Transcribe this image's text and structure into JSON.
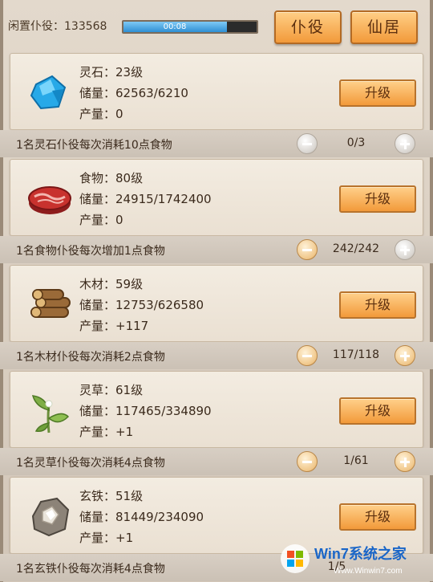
{
  "header": {
    "idle_label": "闲置仆役：133568",
    "timer": "00:08",
    "timer_progress": 0.78,
    "btn_servant": "仆役",
    "btn_residence": "仙居"
  },
  "resources": [
    {
      "name": "灵石：23级",
      "storage": "储量：62563/6210",
      "output": "产量：0",
      "upgrade": "升级",
      "cost_text": "1名灵石仆役每次消耗10点食物",
      "count": "0/3",
      "icon": "blue-crystal-icon"
    },
    {
      "name": "食物：80级",
      "storage": "储量：24915/1742400",
      "output": "产量：0",
      "upgrade": "升级",
      "cost_text": "1名食物仆役每次增加1点食物",
      "count": "242/242",
      "icon": "meat-icon"
    },
    {
      "name": "木材：59级",
      "storage": "储量：12753/626580",
      "output": "产量：+117",
      "upgrade": "升级",
      "cost_text": "1名木材仆役每次消耗2点食物",
      "count": "117/118",
      "icon": "wood-logs-icon"
    },
    {
      "name": "灵草：61级",
      "storage": "储量：117465/334890",
      "output": "产量：+1",
      "upgrade": "升级",
      "cost_text": "1名灵草仆役每次消耗4点食物",
      "count": "1/61",
      "icon": "herb-icon"
    },
    {
      "name": "玄铁：51级",
      "storage": "储量：81449/234090",
      "output": "产量：+1",
      "upgrade": "升级",
      "cost_text": "1名玄铁仆役每次消耗4点食物",
      "count": "1/5",
      "icon": "black-iron-ore-icon"
    }
  ],
  "watermark": {
    "title": "Win7系统之家",
    "url": "Www.Winwin7.com"
  }
}
